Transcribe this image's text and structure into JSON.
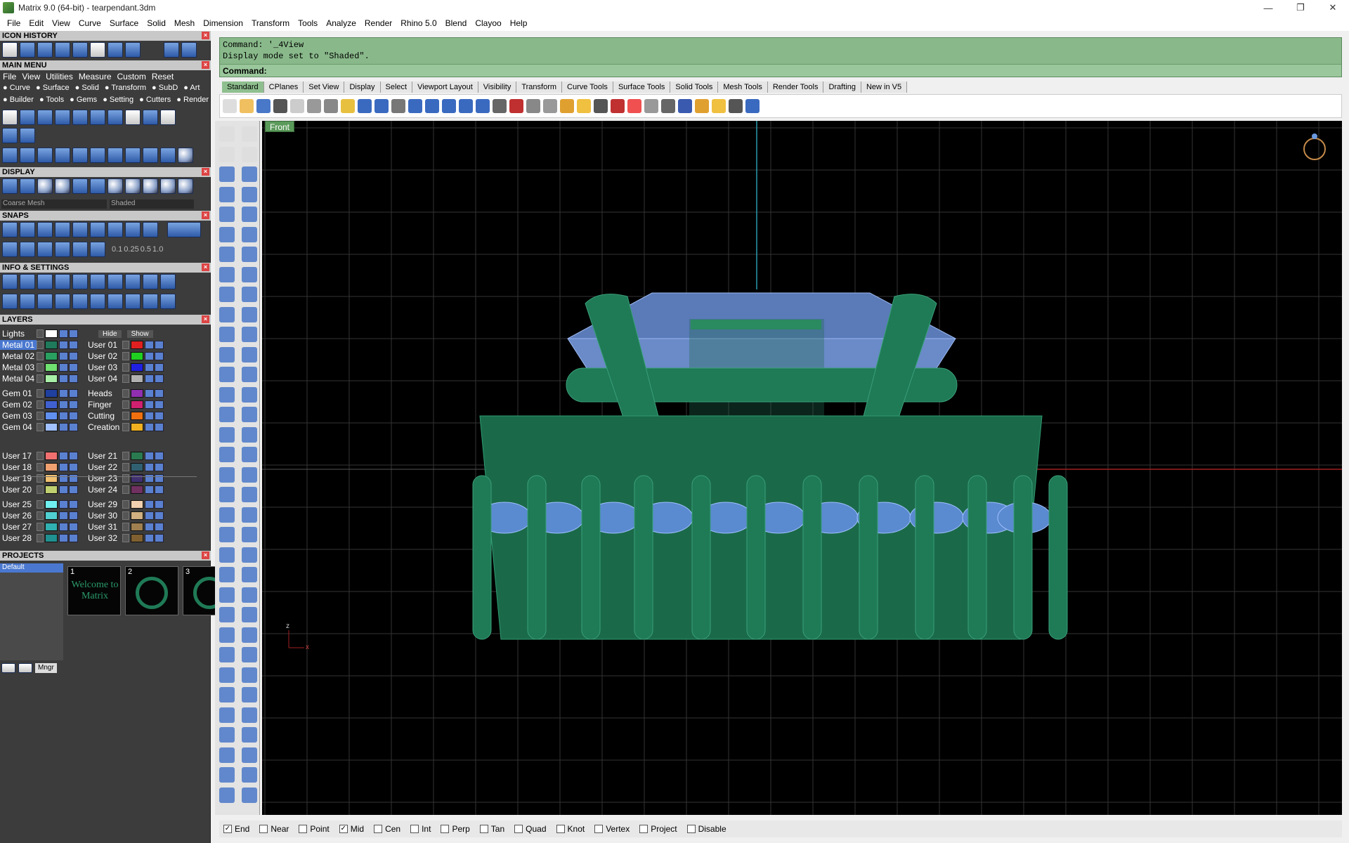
{
  "window": {
    "title": "Matrix 9.0 (64-bit) - tearpendant.3dm",
    "minimize": "—",
    "restore": "❐",
    "close": "✕"
  },
  "menu": [
    "File",
    "Edit",
    "View",
    "Curve",
    "Surface",
    "Solid",
    "Mesh",
    "Dimension",
    "Transform",
    "Tools",
    "Analyze",
    "Render",
    "Rhino 5.0",
    "Blend",
    "Clayoo",
    "Help"
  ],
  "left": {
    "icon_history": "ICON HISTORY",
    "main_menu": "MAIN MENU",
    "main_menu_row1": [
      "File",
      "View",
      "Utilities",
      "Measure",
      "Custom",
      "Reset"
    ],
    "main_menu_row2": [
      "Curve",
      "Surface",
      "Solid",
      "Transform",
      "SubD",
      "Art"
    ],
    "main_menu_row3": [
      "Builder",
      "Tools",
      "Gems",
      "Setting",
      "Cutters",
      "Render"
    ],
    "display": "DISPLAY",
    "display_mesh": "Coarse Mesh",
    "display_mode": "Shaded",
    "snaps": "SNAPS",
    "snap_values": [
      "0.1",
      "0.25",
      "0.5",
      "1.0"
    ],
    "info_settings": "INFO & SETTINGS",
    "layers": "LAYERS",
    "lights": "Lights",
    "hide": "Hide",
    "show": "Show",
    "layer_rows": [
      {
        "a": "Metal 01",
        "ac": "#1e7a5a",
        "b": "User 01",
        "bc": "#e02020"
      },
      {
        "a": "Metal 02",
        "ac": "#2aa060",
        "b": "User 02",
        "bc": "#20d020"
      },
      {
        "a": "Metal 03",
        "ac": "#70e070",
        "b": "User 03",
        "bc": "#2020e0"
      },
      {
        "a": "Metal 04",
        "ac": "#a8f0a8",
        "b": "User 04",
        "bc": "#b0b0b0"
      },
      {
        "a": "Gem 01",
        "ac": "#2040a0",
        "b": "Heads",
        "bc": "#9030b0"
      },
      {
        "a": "Gem 02",
        "ac": "#4060d0",
        "b": "Finger",
        "bc": "#d02070"
      },
      {
        "a": "Gem 03",
        "ac": "#6090f0",
        "b": "Cutting",
        "bc": "#f07010"
      },
      {
        "a": "Gem 04",
        "ac": "#a0c0ff",
        "b": "Creation",
        "bc": "#f0b020"
      },
      {
        "a": "User 17",
        "ac": "#f07070",
        "b": "User 21",
        "bc": "#2a7a50"
      },
      {
        "a": "User 18",
        "ac": "#f0a070",
        "b": "User 22",
        "bc": "#306070"
      },
      {
        "a": "User 19",
        "ac": "#f0c070",
        "b": "User 23",
        "bc": "#403070"
      },
      {
        "a": "User 20",
        "ac": "#c0d070",
        "b": "User 24",
        "bc": "#703060"
      },
      {
        "a": "User 25",
        "ac": "#70f0f0",
        "b": "User 29",
        "bc": "#f0d0b0"
      },
      {
        "a": "User 26",
        "ac": "#50d0d0",
        "b": "User 30",
        "bc": "#d0b080"
      },
      {
        "a": "User 27",
        "ac": "#30b0b0",
        "b": "User 31",
        "bc": "#a08050"
      },
      {
        "a": "User 28",
        "ac": "#209090",
        "b": "User 32",
        "bc": "#806030"
      }
    ],
    "projects": "PROJECTS",
    "project_default": "Default",
    "thumbs": [
      {
        "n": "1",
        "t": "Welcome to Matrix"
      },
      {
        "n": "2",
        "t": ""
      },
      {
        "n": "3",
        "t": ""
      }
    ],
    "mngr": "Mngr"
  },
  "command": {
    "line1": "Command: '_4View",
    "line2": "Display mode set to \"Shaded\".",
    "prompt": "Command:"
  },
  "tabs": [
    "Standard",
    "CPlanes",
    "Set View",
    "Display",
    "Select",
    "Viewport Layout",
    "Visibility",
    "Transform",
    "Curve Tools",
    "Surface Tools",
    "Solid Tools",
    "Mesh Tools",
    "Render Tools",
    "Drafting",
    "New in V5"
  ],
  "viewport": {
    "label": "Front",
    "axis_x": "x",
    "axis_z": "z"
  },
  "osnaps": [
    {
      "label": "End",
      "checked": true
    },
    {
      "label": "Near",
      "checked": false
    },
    {
      "label": "Point",
      "checked": false
    },
    {
      "label": "Mid",
      "checked": true
    },
    {
      "label": "Cen",
      "checked": false
    },
    {
      "label": "Int",
      "checked": false
    },
    {
      "label": "Perp",
      "checked": false
    },
    {
      "label": "Tan",
      "checked": false
    },
    {
      "label": "Quad",
      "checked": false
    },
    {
      "label": "Knot",
      "checked": false
    },
    {
      "label": "Vertex",
      "checked": false
    },
    {
      "label": "Project",
      "checked": false
    },
    {
      "label": "Disable",
      "checked": false
    }
  ],
  "colors": {
    "accent_green": "#89b98a",
    "metal": "#1f7a56",
    "gem": "#6a9ae0"
  }
}
